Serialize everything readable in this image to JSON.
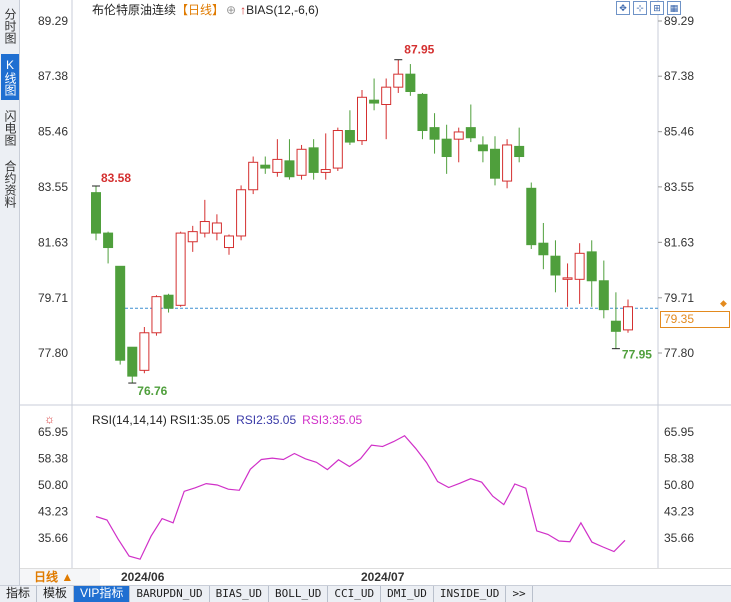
{
  "sidebar": {
    "tabs": [
      {
        "label": "分时图",
        "active": false
      },
      {
        "label": "K线图",
        "active": true
      },
      {
        "label": "闪电图",
        "active": false
      },
      {
        "label": "合约资料",
        "active": false
      }
    ]
  },
  "header": {
    "title": "布伦特原油连续",
    "period": "【日线】",
    "zoom_icon": "⊕",
    "bias_icon": "↑",
    "bias": "BIAS(12,-6,6)"
  },
  "toolbar": {
    "icons": [
      "expand-icon",
      "move-icon",
      "text-icon",
      "grid-icon"
    ],
    "glyphs": [
      "✥",
      "⊹",
      "⊞",
      "▦"
    ]
  },
  "price_marker": {
    "value": "79.35",
    "color": "#e38a1e"
  },
  "annotations": {
    "high": "87.95",
    "start": "83.58",
    "low1": "76.76",
    "low2": "77.95"
  },
  "rsi_header": {
    "main": "RSI(14,14,14) RSI1:35.05",
    "rsi2": "RSI2:35.05",
    "rsi3": "RSI3:35.05"
  },
  "footer": {
    "period_label": "日线 ▲",
    "dates": [
      "2024/06",
      "2024/07"
    ]
  },
  "bottom_tabs": [
    {
      "label": "指标",
      "active": false,
      "cn": true
    },
    {
      "label": "模板",
      "active": false,
      "cn": true
    },
    {
      "label": "VIP指标",
      "active": true,
      "cn": true
    },
    {
      "label": "BARUPDN_UD",
      "active": false,
      "cn": false
    },
    {
      "label": "BIAS_UD",
      "active": false,
      "cn": false
    },
    {
      "label": "BOLL_UD",
      "active": false,
      "cn": false
    },
    {
      "label": "CCI_UD",
      "active": false,
      "cn": false
    },
    {
      "label": "DMI_UD",
      "active": false,
      "cn": false
    },
    {
      "label": "INSIDE_UD",
      "active": false,
      "cn": false
    },
    {
      "label": ">>",
      "active": false,
      "cn": false
    }
  ],
  "chart_data": [
    {
      "type": "candlestick",
      "title": "布伦特原油连续",
      "y_ticks": [
        "89.29",
        "87.38",
        "85.46",
        "83.55",
        "81.63",
        "79.71",
        "77.80"
      ],
      "ylim": [
        77.8,
        89.29
      ],
      "reference_line": 79.35,
      "x_labels": [
        "2024/06",
        "2024/07"
      ],
      "up_color": "#d43030",
      "down_color": "#4f9f3c",
      "candles": [
        {
          "o": 83.35,
          "h": 83.58,
          "l": 81.7,
          "c": 81.95
        },
        {
          "o": 81.95,
          "h": 82.0,
          "l": 80.9,
          "c": 81.45
        },
        {
          "o": 80.8,
          "h": 80.8,
          "l": 77.4,
          "c": 77.55
        },
        {
          "o": 78.0,
          "h": 78.0,
          "l": 76.76,
          "c": 77.0
        },
        {
          "o": 77.2,
          "h": 78.7,
          "l": 77.1,
          "c": 78.5
        },
        {
          "o": 78.5,
          "h": 79.8,
          "l": 78.4,
          "c": 79.75
        },
        {
          "o": 79.8,
          "h": 79.85,
          "l": 79.2,
          "c": 79.35
        },
        {
          "o": 79.45,
          "h": 82.0,
          "l": 79.4,
          "c": 81.95
        },
        {
          "o": 81.65,
          "h": 82.2,
          "l": 81.3,
          "c": 82.0
        },
        {
          "o": 81.95,
          "h": 83.1,
          "l": 81.8,
          "c": 82.35
        },
        {
          "o": 81.95,
          "h": 82.6,
          "l": 81.7,
          "c": 82.3
        },
        {
          "o": 81.45,
          "h": 81.9,
          "l": 81.2,
          "c": 81.85
        },
        {
          "o": 81.85,
          "h": 83.6,
          "l": 81.7,
          "c": 83.45
        },
        {
          "o": 83.45,
          "h": 84.6,
          "l": 83.3,
          "c": 84.4
        },
        {
          "o": 84.3,
          "h": 84.6,
          "l": 84.0,
          "c": 84.2
        },
        {
          "o": 84.05,
          "h": 85.2,
          "l": 83.9,
          "c": 84.5
        },
        {
          "o": 84.45,
          "h": 85.2,
          "l": 83.8,
          "c": 83.9
        },
        {
          "o": 83.95,
          "h": 85.0,
          "l": 83.8,
          "c": 84.85
        },
        {
          "o": 84.9,
          "h": 85.2,
          "l": 83.8,
          "c": 84.05
        },
        {
          "o": 84.05,
          "h": 85.4,
          "l": 83.8,
          "c": 84.15
        },
        {
          "o": 84.2,
          "h": 85.6,
          "l": 84.1,
          "c": 85.5
        },
        {
          "o": 85.5,
          "h": 86.2,
          "l": 85.0,
          "c": 85.1
        },
        {
          "o": 85.15,
          "h": 86.9,
          "l": 85.0,
          "c": 86.65
        },
        {
          "o": 86.55,
          "h": 87.3,
          "l": 86.2,
          "c": 86.45
        },
        {
          "o": 86.4,
          "h": 87.3,
          "l": 85.2,
          "c": 87.0
        },
        {
          "o": 87.0,
          "h": 87.95,
          "l": 86.8,
          "c": 87.45
        },
        {
          "o": 87.45,
          "h": 87.8,
          "l": 86.7,
          "c": 86.85
        },
        {
          "o": 86.75,
          "h": 86.8,
          "l": 85.2,
          "c": 85.5
        },
        {
          "o": 85.6,
          "h": 86.1,
          "l": 84.7,
          "c": 85.2
        },
        {
          "o": 85.2,
          "h": 85.7,
          "l": 84.0,
          "c": 84.6
        },
        {
          "o": 85.2,
          "h": 85.6,
          "l": 84.4,
          "c": 85.45
        },
        {
          "o": 85.6,
          "h": 86.4,
          "l": 85.1,
          "c": 85.25
        },
        {
          "o": 85.0,
          "h": 85.3,
          "l": 84.4,
          "c": 84.8
        },
        {
          "o": 84.85,
          "h": 85.3,
          "l": 83.6,
          "c": 83.85
        },
        {
          "o": 83.75,
          "h": 85.2,
          "l": 83.5,
          "c": 85.0
        },
        {
          "o": 84.95,
          "h": 85.6,
          "l": 84.4,
          "c": 84.6
        },
        {
          "o": 83.5,
          "h": 83.7,
          "l": 81.4,
          "c": 81.55
        },
        {
          "o": 81.6,
          "h": 82.3,
          "l": 80.7,
          "c": 81.2
        },
        {
          "o": 81.15,
          "h": 81.7,
          "l": 79.9,
          "c": 80.5
        },
        {
          "o": 80.35,
          "h": 80.9,
          "l": 79.4,
          "c": 80.4
        },
        {
          "o": 80.35,
          "h": 81.6,
          "l": 79.5,
          "c": 81.25
        },
        {
          "o": 81.3,
          "h": 81.7,
          "l": 79.4,
          "c": 80.3
        },
        {
          "o": 80.3,
          "h": 81.0,
          "l": 79.0,
          "c": 79.3
        },
        {
          "o": 78.9,
          "h": 79.9,
          "l": 77.95,
          "c": 78.55
        },
        {
          "o": 78.6,
          "h": 79.65,
          "l": 78.5,
          "c": 79.4
        }
      ]
    },
    {
      "type": "line",
      "title": "RSI(14,14,14)",
      "y_ticks": [
        "65.95",
        "58.38",
        "50.80",
        "43.23",
        "35.66"
      ],
      "ylim": [
        35.66,
        65.95
      ],
      "series": [
        {
          "name": "RSI3",
          "color": "#d030c8",
          "values": [
            41.8,
            40.8,
            35.4,
            30.5,
            29.6,
            36.2,
            41.2,
            40.0,
            49.0,
            50.0,
            51.2,
            50.8,
            49.6,
            49.3,
            55.3,
            58.1,
            58.5,
            58.1,
            59.8,
            58.3,
            57.3,
            55.2,
            58.0,
            56.1,
            58.3,
            62.2,
            61.8,
            63.2,
            64.9,
            61.3,
            57.2,
            51.8,
            50.1,
            51.3,
            52.6,
            51.6,
            47.6,
            45.2,
            51.1,
            49.9,
            37.7,
            36.7,
            34.8,
            34.6,
            40.0,
            34.5,
            33.1,
            31.8,
            35.0
          ]
        }
      ]
    }
  ]
}
